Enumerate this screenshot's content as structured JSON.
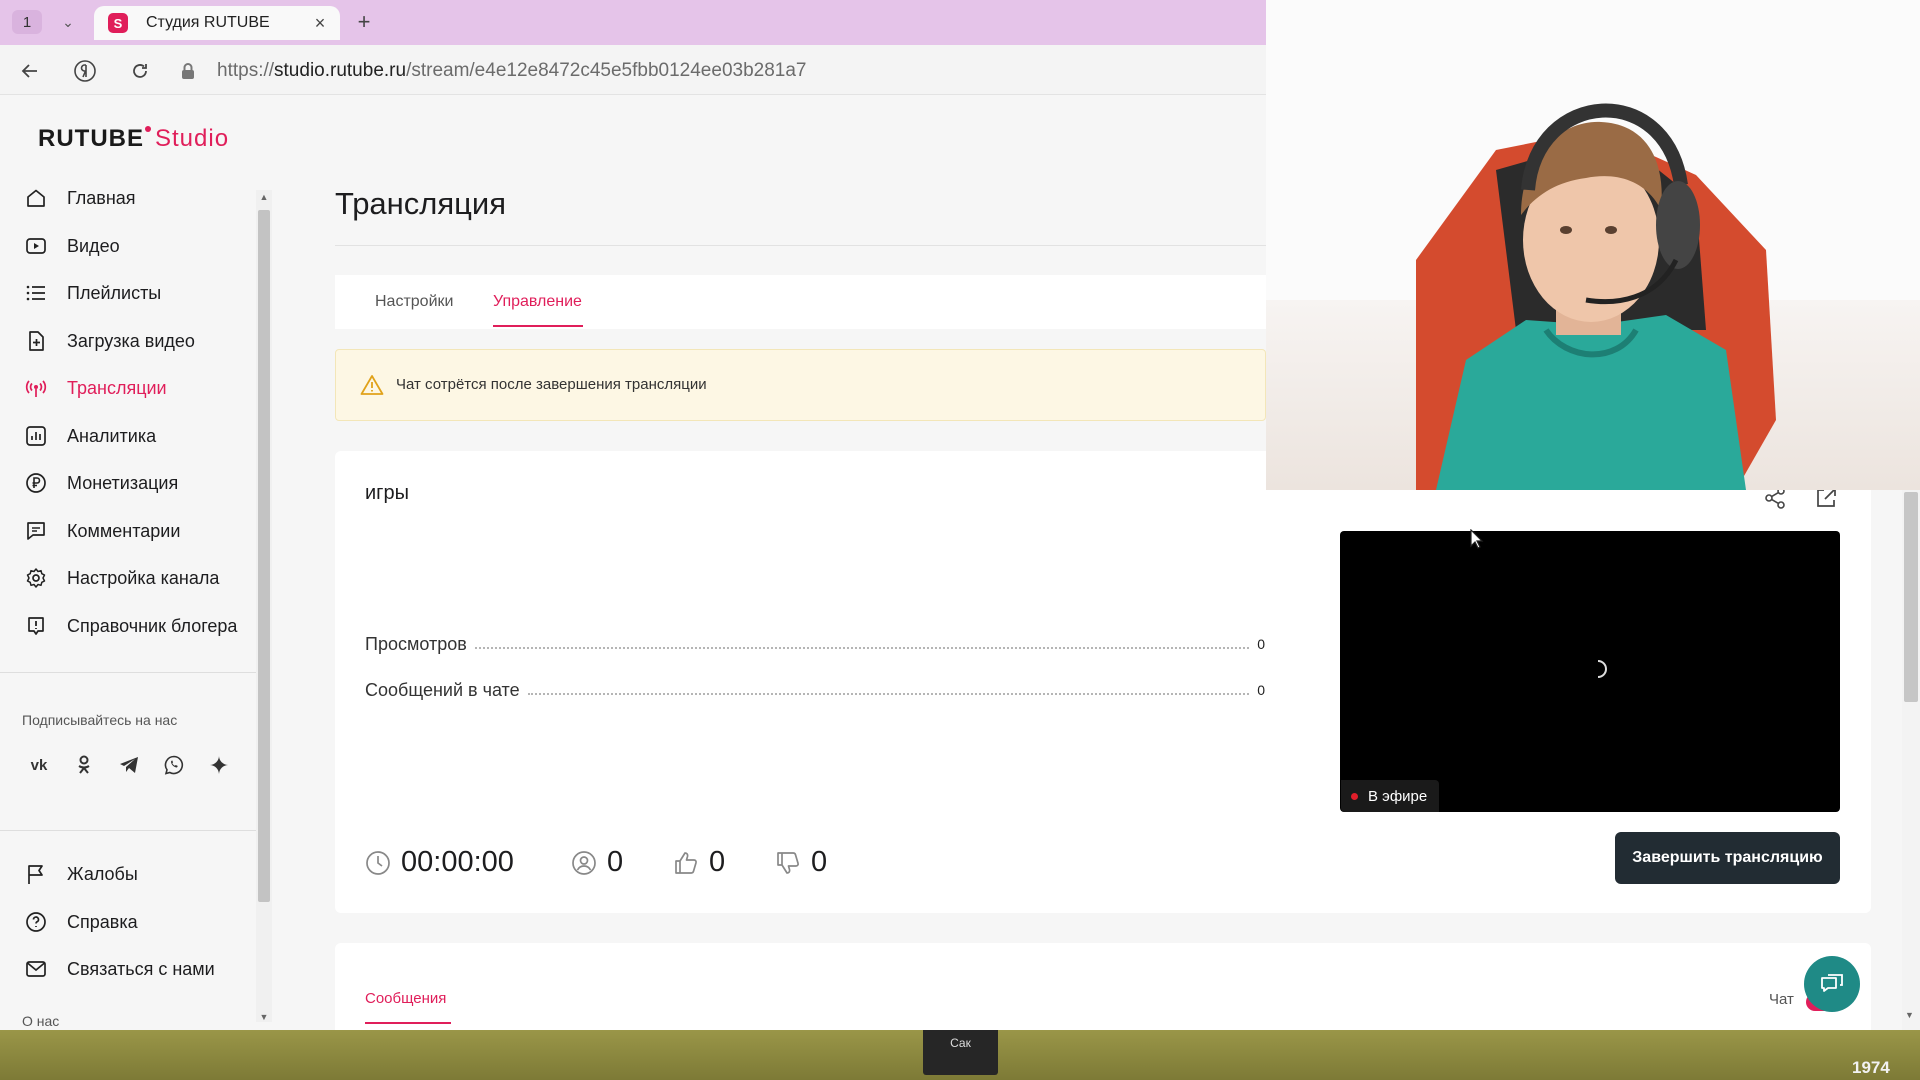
{
  "browser": {
    "tab_count": "1",
    "tab_title": "Студия RUTUBE",
    "url_prefix": "https://",
    "url_host": "studio.rutube.ru",
    "url_path": "/stream/e4e12e8472c45e5fbb0124ee03b281a7"
  },
  "logo": {
    "main": "RUTUBE",
    "sub": "Studio"
  },
  "sidebar": {
    "items": [
      {
        "label": "Главная",
        "icon": "home-icon"
      },
      {
        "label": "Видео",
        "icon": "video-icon"
      },
      {
        "label": "Плейлисты",
        "icon": "playlist-icon"
      },
      {
        "label": "Загрузка видео",
        "icon": "upload-icon"
      },
      {
        "label": "Трансляции",
        "icon": "broadcast-icon",
        "active": true
      },
      {
        "label": "Аналитика",
        "icon": "analytics-icon"
      },
      {
        "label": "Монетизация",
        "icon": "ruble-icon"
      },
      {
        "label": "Комментарии",
        "icon": "comment-icon"
      },
      {
        "label": "Настройка канала",
        "icon": "gear-icon"
      },
      {
        "label": "Справочник блогера",
        "icon": "info-icon"
      }
    ],
    "follow_label": "Подписывайтесь на нас",
    "socials": [
      "vk-icon",
      "ok-icon",
      "telegram-icon",
      "viber-icon",
      "dzen-icon"
    ],
    "bottom_items": [
      {
        "label": "Жалобы",
        "icon": "flag-icon"
      },
      {
        "label": "Справка",
        "icon": "help-icon"
      },
      {
        "label": "Связаться с нами",
        "icon": "mail-icon"
      }
    ],
    "about": "О нас"
  },
  "main": {
    "title": "Трансляция",
    "tabs": [
      {
        "label": "Настройки"
      },
      {
        "label": "Управление",
        "active": true
      }
    ],
    "alert": "Чат сотрётся после завершения трансляции",
    "stream": {
      "name": "игры",
      "stats": [
        {
          "label": "Просмотров",
          "value": "0"
        },
        {
          "label": "Сообщений в чате",
          "value": "0"
        }
      ],
      "duration": "00:00:00",
      "viewers": "0",
      "likes": "0",
      "dislikes": "0",
      "live_label": "В эфире",
      "end_button": "Завершить трансляцию"
    },
    "messages_tab": "Сообщения",
    "chat_label": "Чат"
  },
  "taskbar": {
    "item_label": "Сак",
    "number": "1974"
  },
  "colors": {
    "accent": "#e01e5a",
    "dark_button": "#222c33",
    "fab": "#1f8a86"
  }
}
